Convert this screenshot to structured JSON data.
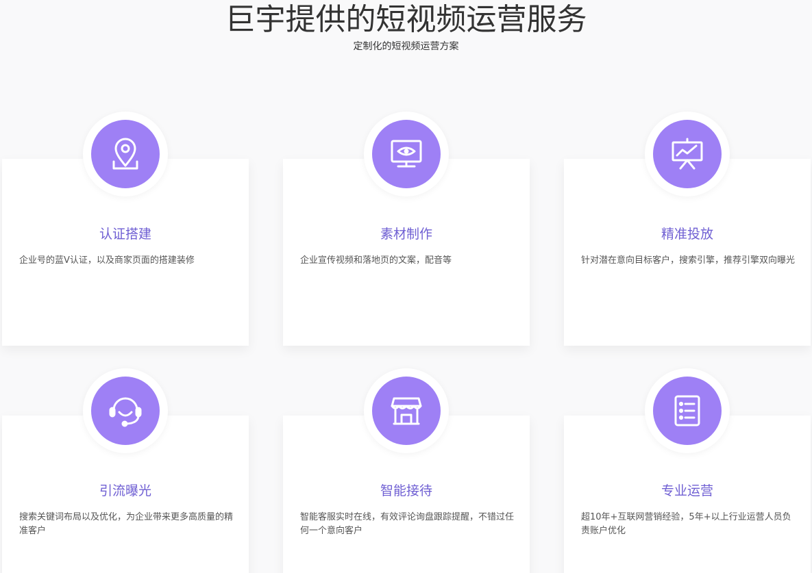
{
  "header": {
    "title": "巨宇提供的短视频运营服务",
    "subtitle": "定制化的短视频运营方案"
  },
  "accent_color": "#9e80f5",
  "title_color": "#6f5fd3",
  "services": [
    {
      "icon": "location-pin-icon",
      "title": "认证搭建",
      "description": "企业号的蓝V认证，以及商家页面的搭建装修"
    },
    {
      "icon": "monitor-eye-icon",
      "title": "素材制作",
      "description": "企业宣传视频和落地页的文案，配音等"
    },
    {
      "icon": "presentation-chart-icon",
      "title": "精准投放",
      "description": "针对潜在意向目标客户，搜索引擎，推荐引擎双向曝光"
    },
    {
      "icon": "headset-icon",
      "title": "引流曝光",
      "description": "搜索关键词布局以及优化，为企业带来更多高质量的精准客户"
    },
    {
      "icon": "storefront-icon",
      "title": "智能接待",
      "description": "智能客服实时在线，有效评论询盘跟踪提醒，不错过任何一个意向客户"
    },
    {
      "icon": "list-document-icon",
      "title": "专业运营",
      "description": "超10年+互联网营销经验，5年+以上行业运营人员负责账户优化"
    }
  ]
}
